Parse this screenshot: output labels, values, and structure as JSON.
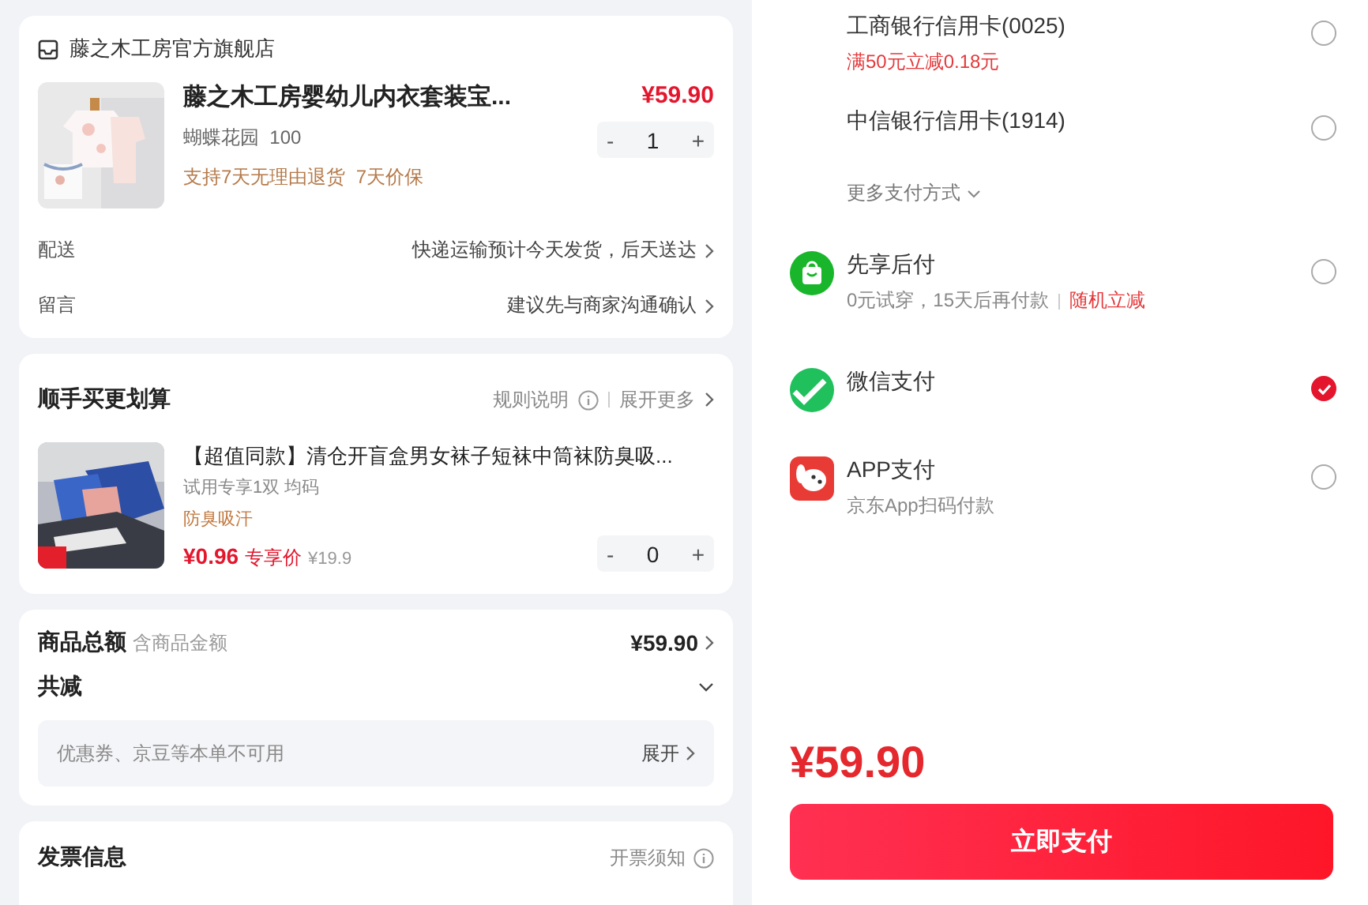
{
  "store": {
    "name": "藤之木工房官方旗舰店"
  },
  "product": {
    "title": "藤之木工房婴幼儿内衣套装宝...",
    "spec": "蝴蝶花园  100",
    "services": "支持7天无理由退货  7天价保",
    "price": "¥59.90",
    "quantity": "1",
    "minus": "-",
    "plus": "+"
  },
  "order_rows": [
    {
      "label": "配送",
      "value": "快递运输预计今天发货，后天送达"
    },
    {
      "label": "留言",
      "value": "建议先与商家沟通确认"
    }
  ],
  "addon": {
    "title": "顺手买更划算",
    "rules": "规则说明",
    "more": "展开更多",
    "item": {
      "title": "【超值同款】清仓开盲盒男女袜子短袜中筒袜防臭吸...",
      "spec": "试用专享1双 均码",
      "tag": "防臭吸汗",
      "price": "¥0.96",
      "price_label": "专享价",
      "original_price": "¥19.9",
      "quantity": "0",
      "minus": "-",
      "plus": "+"
    }
  },
  "summary": {
    "total_label": "商品总额",
    "total_note": "含商品金额",
    "total": "¥59.90",
    "discount_label": "共减",
    "expanded": false,
    "coupon_note": "优惠券、京豆等本单不可用",
    "coupon_action": "展开"
  },
  "invoice": {
    "title": "发票信息",
    "notice": "开票须知"
  },
  "payment_methods": [
    {
      "kind": "bank",
      "name": "工商银行信用卡(0025)",
      "promo": "满50元立减0.18元",
      "selected": false
    },
    {
      "kind": "bank",
      "name": "中信银行信用卡(1914)",
      "selected": false
    },
    {
      "kind": "more",
      "name": "更多支付方式"
    },
    {
      "kind": "later",
      "name": "先享后付",
      "note": "0元试穿，15天后再付款",
      "promo": "随机立减",
      "selected": false
    },
    {
      "kind": "wechat",
      "name": "微信支付",
      "selected": true
    },
    {
      "kind": "app",
      "name": "APP支付",
      "note": "京东App扫码付款",
      "selected": false
    }
  ],
  "pay": {
    "amount": "¥59.90",
    "button": "立即支付"
  }
}
